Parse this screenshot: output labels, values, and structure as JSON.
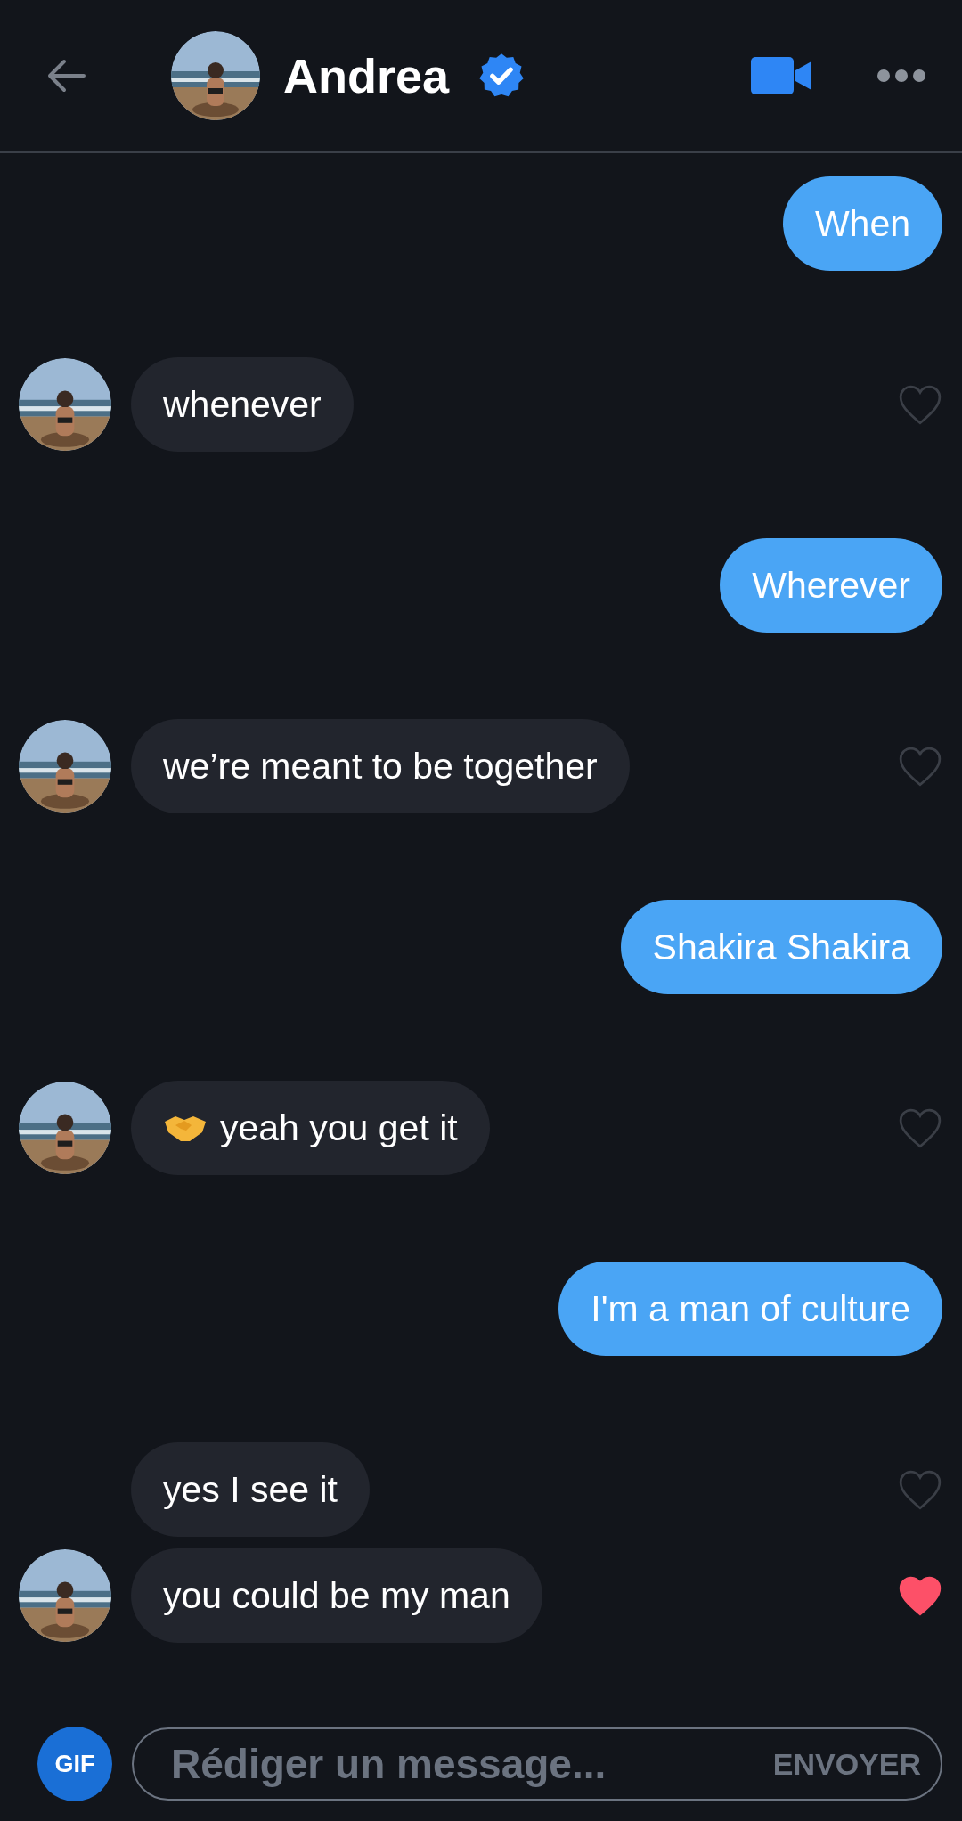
{
  "header": {
    "name": "Andrea",
    "verified": true
  },
  "messages": [
    {
      "kind": "sent",
      "text": "When"
    },
    {
      "kind": "received",
      "text": "whenever",
      "liked": false,
      "avatar": true
    },
    {
      "kind": "sent",
      "text": "Wherever"
    },
    {
      "kind": "received",
      "text": "we’re meant to be together",
      "liked": false,
      "avatar": true
    },
    {
      "kind": "sent",
      "text": "Shakira Shakira"
    },
    {
      "kind": "received-emoji",
      "text": "yeah you get it",
      "liked": false,
      "avatar": true
    },
    {
      "kind": "sent",
      "text": "I'm a man of culture"
    },
    {
      "kind": "received",
      "text": "yes I see it",
      "liked": false,
      "avatar": false
    },
    {
      "kind": "received",
      "text": "you could be my man",
      "liked": true,
      "avatar": true
    }
  ],
  "composer": {
    "gif": "GIF",
    "placeholder": "Rédiger un message...",
    "send": "ENVOYER"
  }
}
